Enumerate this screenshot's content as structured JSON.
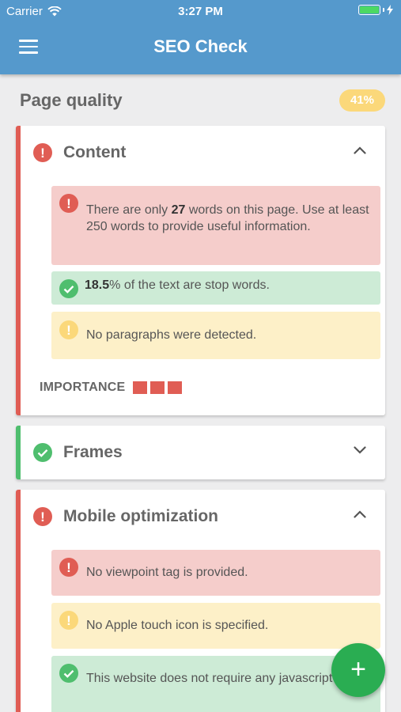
{
  "status_bar": {
    "carrier": "Carrier",
    "time": "3:27 PM"
  },
  "header": {
    "title": "SEO Check"
  },
  "section": {
    "title": "Page quality",
    "score": "41%"
  },
  "cards": [
    {
      "title": "Content",
      "state": "error",
      "expanded": true,
      "messages": [
        {
          "type": "error",
          "pre": "There are only ",
          "bold": "27",
          "post": " words on this page. Use at least 250 words to provide useful information."
        },
        {
          "type": "success",
          "pre": "",
          "bold": "18.5",
          "post": "% of the text are stop words."
        },
        {
          "type": "warning",
          "text": "No paragraphs were detected."
        }
      ],
      "importance_label": "IMPORTANCE",
      "importance_level": 3
    },
    {
      "title": "Frames",
      "state": "success",
      "expanded": false
    },
    {
      "title": "Mobile optimization",
      "state": "error",
      "expanded": true,
      "messages": [
        {
          "type": "error",
          "text": "No viewpoint tag is provided."
        },
        {
          "type": "warning",
          "text": "No Apple touch icon is specified."
        },
        {
          "type": "success",
          "text": "This website does not require any javascript files."
        }
      ]
    }
  ],
  "fab": {
    "icon": "plus-icon",
    "label": "+"
  },
  "colors": {
    "header": "#5599cc",
    "error": "#e05d54",
    "success": "#4fbe6e",
    "warning": "#fbd87a",
    "fab": "#2aad52"
  }
}
